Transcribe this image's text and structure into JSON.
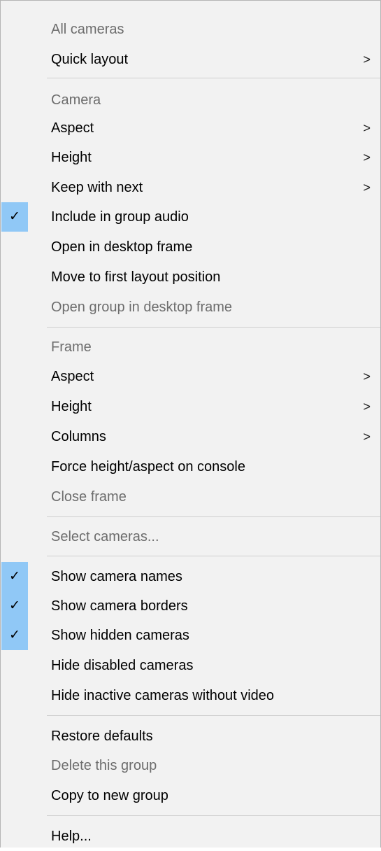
{
  "menu": {
    "all_cameras_header": "All cameras",
    "quick_layout": "Quick layout",
    "camera_header": "Camera",
    "camera_aspect": "Aspect",
    "camera_height": "Height",
    "keep_with_next": "Keep with next",
    "include_group_audio": "Include in group audio",
    "open_desktop_frame": "Open in desktop frame",
    "move_first_layout": "Move to first layout position",
    "open_group_desktop_frame": "Open group in desktop frame",
    "frame_header": "Frame",
    "frame_aspect": "Aspect",
    "frame_height": "Height",
    "columns": "Columns",
    "force_height_aspect": "Force height/aspect on console",
    "close_frame": "Close frame",
    "select_cameras": "Select cameras...",
    "show_camera_names": "Show camera names",
    "show_camera_borders": "Show camera borders",
    "show_hidden_cameras": "Show hidden cameras",
    "hide_disabled_cameras": "Hide disabled cameras",
    "hide_inactive_cameras": "Hide inactive cameras without video",
    "restore_defaults": "Restore defaults",
    "delete_group": "Delete this group",
    "copy_new_group": "Copy to new group",
    "help": "Help..."
  },
  "glyphs": {
    "submenu_arrow": ">",
    "checkmark": "✓"
  },
  "checked_state": {
    "include_group_audio": true,
    "show_camera_names": true,
    "show_camera_borders": true,
    "show_hidden_cameras": true
  },
  "colors": {
    "menu_background": "#f2f2f2",
    "check_highlight": "#90c8f6",
    "disabled_text": "#6d6d6d",
    "separator": "#cfcfcf"
  }
}
